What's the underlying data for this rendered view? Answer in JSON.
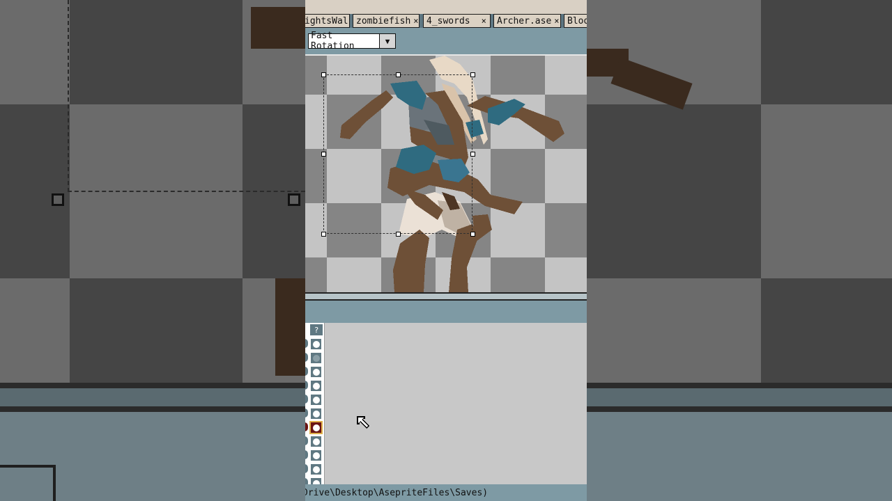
{
  "tabs": [
    {
      "label": "ightsWal",
      "close_icon": "×"
    },
    {
      "label": "zombiefish",
      "close_icon": "×"
    },
    {
      "label": "4_swords",
      "close_icon": "×"
    },
    {
      "label": "Archer.ase",
      "close_icon": "×"
    },
    {
      "label": "Bloo",
      "close_icon": ""
    }
  ],
  "toolbar": {
    "rotation_algorithm": "Fast Rotation",
    "dropdown_icon": "chevron-down-icon"
  },
  "timeline": {
    "header_glyph": "?",
    "active_layer_index": 7
  },
  "status": {
    "path_text": "Drive\\Desktop\\AsepriteFiles\\Saves)"
  },
  "colors": {
    "tab_bar": "#5d7682",
    "panel_teal": "#7e9aa4",
    "tab_face": "#dcd2c4",
    "checker_light": "#c4c4c4",
    "checker_dark": "#858585",
    "sprite_brown": "#6e5037",
    "sprite_teal": "#2f6b80",
    "sprite_cream": "#e6d8c6",
    "active_layer": "#6a1414"
  }
}
